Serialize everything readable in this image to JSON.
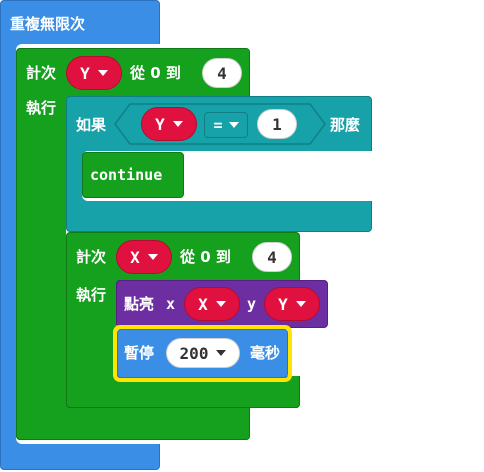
{
  "forever": {
    "label": "重複無限次"
  },
  "outer_loop": {
    "label_for": "計次",
    "var": "Y",
    "label_from": "從 0 到",
    "count": "4",
    "label_do": "執行"
  },
  "if_block": {
    "label_if": "如果",
    "left_var": "Y",
    "operator": "=",
    "right_value": "1",
    "label_then": "那麼",
    "body": "continue"
  },
  "inner_loop": {
    "label_for": "計次",
    "var": "X",
    "label_from": "從 0 到",
    "count": "4",
    "label_do": "執行"
  },
  "plot": {
    "label": "點亮",
    "x_label": "x",
    "x_var": "X",
    "y_label": "y",
    "y_var": "Y"
  },
  "pause": {
    "label": "暫停",
    "value": "200",
    "unit": "毫秒"
  },
  "colors": {
    "basic_blue": "#3a8ee6",
    "loops_green": "#15a01e",
    "logic_teal": "#17a2a9",
    "led_purple": "#6c2ea0",
    "variable_red": "#e0113e",
    "selection_yellow": "#ffe500"
  }
}
